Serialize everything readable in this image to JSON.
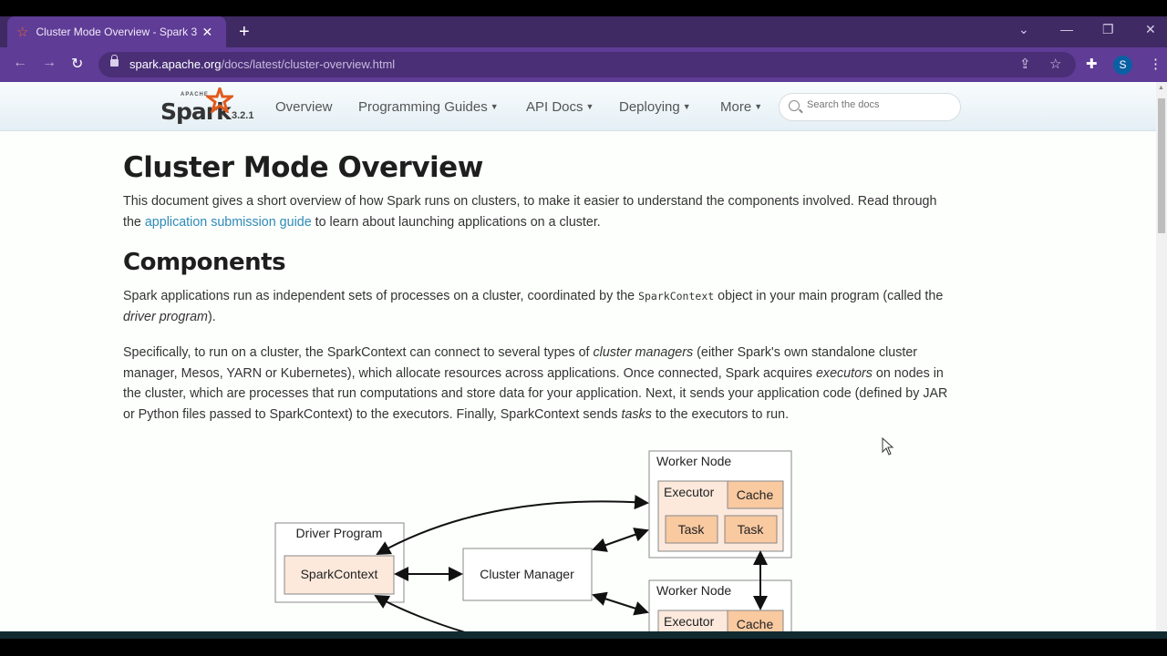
{
  "browser": {
    "tab_title": "Cluster Mode Overview - Spark 3",
    "url_host": "spark.apache.org",
    "url_path": "/docs/latest/cluster-overview.html",
    "profile_initial": "S",
    "icons": [
      "back-icon",
      "forward-icon",
      "reload-icon",
      "lock-icon",
      "share-icon",
      "star-icon",
      "extensions-icon",
      "menu-icon"
    ]
  },
  "navbar": {
    "logo_word": "Spark",
    "logo_apache": "APACHE",
    "version": "3.2.1",
    "items": [
      {
        "label": "Overview",
        "dropdown": false
      },
      {
        "label": "Programming Guides",
        "dropdown": true
      },
      {
        "label": "API Docs",
        "dropdown": true
      },
      {
        "label": "Deploying",
        "dropdown": true
      },
      {
        "label": "More",
        "dropdown": true
      }
    ],
    "search_placeholder": "Search the docs"
  },
  "page": {
    "title": "Cluster Mode Overview",
    "intro_1": "This document gives a short overview of how Spark runs on clusters, to make it easier to understand the components involved. Read through the",
    "intro_link": "application submission guide",
    "intro_2": " to learn about launching applications on a cluster.",
    "components_heading": "Components",
    "comp_p1_a": "Spark applications run as independent sets of processes on a cluster, coordinated by the ",
    "comp_p1_code": "SparkContext",
    "comp_p1_b": " object in your main program (called the ",
    "comp_p1_em": "driver program",
    "comp_p1_c": ").",
    "comp_p2_a": "Specifically, to run on a cluster, the SparkContext can connect to several types of ",
    "comp_p2_em1": "cluster managers",
    "comp_p2_b": " (either Spark's own standalone cluster manager, Mesos, YARN or Kubernetes), which allocate resources across applications. Once connected, Spark acquires ",
    "comp_p2_em2": "executors",
    "comp_p2_c": " on nodes in the cluster, which are processes that run computations and store data for your application. Next, it sends your application code (defined by JAR or Python files passed to SparkContext) to the executors. Finally, SparkContext sends ",
    "comp_p2_em3": "tasks",
    "comp_p2_d": " to the executors to run."
  },
  "diagram": {
    "driver_program": "Driver Program",
    "spark_context": "SparkContext",
    "cluster_manager": "Cluster Manager",
    "worker_node": "Worker Node",
    "executor": "Executor",
    "cache": "Cache",
    "task": "Task",
    "colors": {
      "box_fill": "#fce9dc",
      "inner_fill": "#f9c9a0",
      "border": "#888888"
    }
  }
}
